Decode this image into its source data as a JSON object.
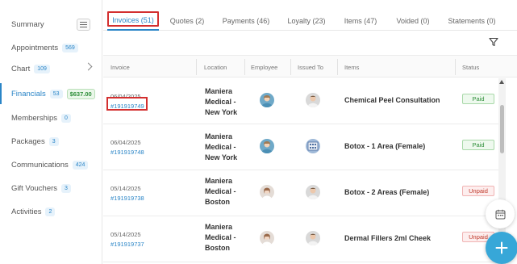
{
  "sidebar": {
    "items": [
      {
        "label": "Summary",
        "badge": ""
      },
      {
        "label": "Appointments",
        "badge": "569"
      },
      {
        "label": "Chart",
        "badge": "109"
      },
      {
        "label": "Financials",
        "badge": "53",
        "amount": "$637.00"
      },
      {
        "label": "Memberships",
        "badge": "0"
      },
      {
        "label": "Packages",
        "badge": "3"
      },
      {
        "label": "Communications",
        "badge": "424"
      },
      {
        "label": "Gift Vouchers",
        "badge": "3"
      },
      {
        "label": "Activities",
        "badge": "2"
      }
    ]
  },
  "tabs": [
    {
      "label": "Invoices (51)",
      "active": true
    },
    {
      "label": "Quotes (2)"
    },
    {
      "label": "Payments (46)"
    },
    {
      "label": "Loyalty (23)"
    },
    {
      "label": "Items (47)"
    },
    {
      "label": "Voided (0)"
    },
    {
      "label": "Statements (0)"
    }
  ],
  "table": {
    "headers": [
      "Invoice",
      "Location",
      "Employee",
      "Issued To",
      "Items",
      "Status"
    ],
    "rows": [
      {
        "date": "06/04/2025",
        "invoice": "#191919749",
        "location": [
          "Maniera",
          "Medical -",
          "New York"
        ],
        "item": "Chemical Peel Consultation",
        "status": "Paid"
      },
      {
        "date": "06/04/2025",
        "invoice": "#191919748",
        "location": [
          "Maniera",
          "Medical -",
          "New York"
        ],
        "item": "Botox - 1 Area (Female)",
        "status": "Paid"
      },
      {
        "date": "05/14/2025",
        "invoice": "#191919738",
        "location": [
          "Maniera",
          "Medical -",
          "Boston"
        ],
        "item": "Botox - 2 Areas (Female)",
        "status": "Unpaid"
      },
      {
        "date": "05/14/2025",
        "invoice": "#191919737",
        "location": [
          "Maniera",
          "Medical -",
          "Boston"
        ],
        "item": "Dermal Fillers 2ml Cheek",
        "status": "Unpaid"
      }
    ]
  },
  "colors": {
    "accent": "#2a85c7",
    "fab": "#37a7d8",
    "highlight": "#d32f2f"
  },
  "icons": {
    "menu": "hamburger-icon",
    "filter": "filter-icon",
    "calendar": "calendar-icon",
    "add": "plus-icon"
  }
}
